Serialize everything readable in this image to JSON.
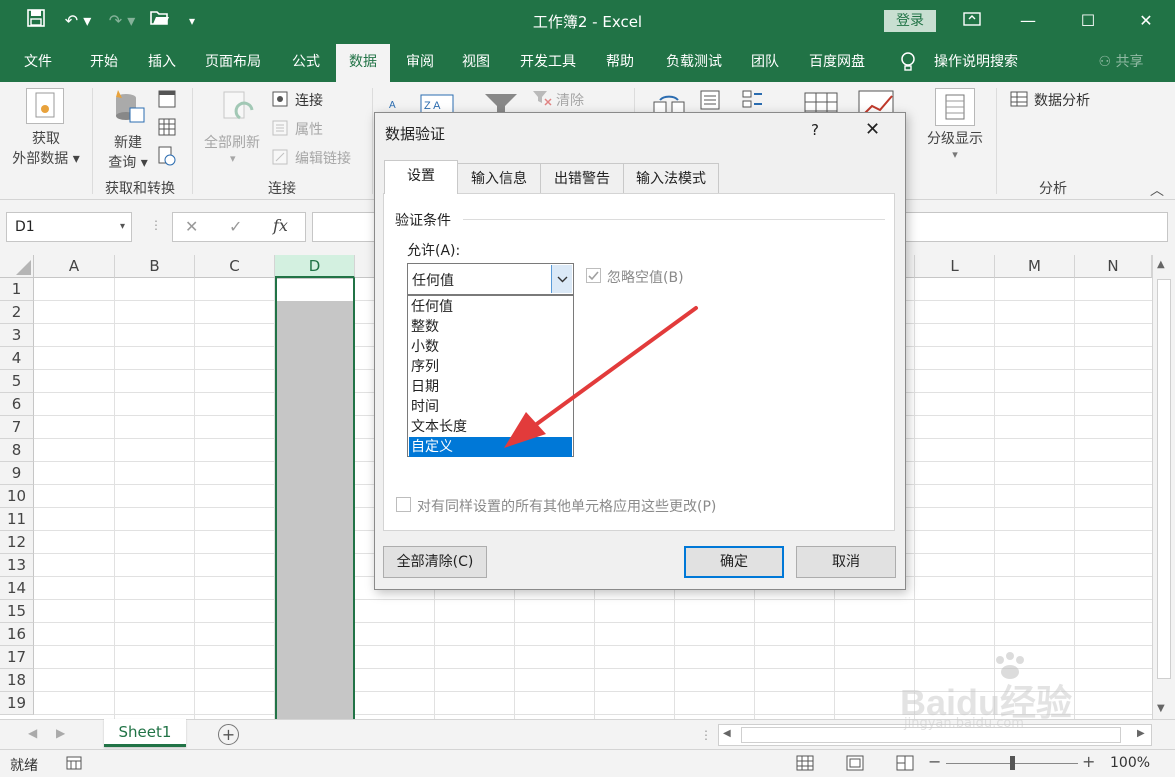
{
  "window": {
    "title": "工作簿2 - Excel",
    "login_label": "登录"
  },
  "tabs": [
    {
      "label": "文件"
    },
    {
      "label": "开始"
    },
    {
      "label": "插入"
    },
    {
      "label": "页面布局"
    },
    {
      "label": "公式"
    },
    {
      "label": "数据"
    },
    {
      "label": "审阅"
    },
    {
      "label": "视图"
    },
    {
      "label": "开发工具"
    },
    {
      "label": "帮助"
    },
    {
      "label": "负载测试"
    },
    {
      "label": "团队"
    },
    {
      "label": "百度网盘"
    }
  ],
  "tell_me": "操作说明搜索",
  "share": "共享",
  "ribbon": {
    "get_external_1": "获取",
    "get_external_2": "外部数据",
    "new_query_1": "新建",
    "new_query_2": "查询",
    "group_get_transform": "获取和转换",
    "refresh_all": "全部刷新",
    "connections": "连接",
    "properties": "属性",
    "edit_links": "编辑链接",
    "group_connections": "连接",
    "clear": "清除",
    "outline": "分级显示",
    "data_analysis": "数据分析",
    "group_analysis": "分析"
  },
  "formula_bar": {
    "name_box": "D1",
    "fx": "fx"
  },
  "grid": {
    "columns": [
      "A",
      "B",
      "C",
      "D",
      "",
      "",
      "",
      "",
      "",
      "",
      "L",
      "M",
      "N"
    ],
    "rows": [
      "1",
      "2",
      "3",
      "4",
      "5",
      "6",
      "7",
      "8",
      "9",
      "10",
      "11",
      "12",
      "13",
      "14",
      "15",
      "16",
      "17",
      "18",
      "19"
    ]
  },
  "sheet": {
    "name": "Sheet1"
  },
  "status": {
    "ready": "就绪",
    "zoom": "100%"
  },
  "dialog": {
    "title": "数据验证",
    "help": "?",
    "tabs": [
      {
        "label": "设置"
      },
      {
        "label": "输入信息"
      },
      {
        "label": "出错警告"
      },
      {
        "label": "输入法模式"
      }
    ],
    "section": "验证条件",
    "allow_label": "允许(A):",
    "allow_value": "任何值",
    "ignore_blank": "忽略空值(B)",
    "options": [
      "任何值",
      "整数",
      "小数",
      "序列",
      "日期",
      "时间",
      "文本长度",
      "自定义"
    ],
    "selected_option": "自定义",
    "apply_all": "对有同样设置的所有其他单元格应用这些更改(P)",
    "clear_all": "全部清除(C)",
    "ok": "确定",
    "cancel": "取消"
  },
  "watermark": {
    "brand": "Baidu经验",
    "url": "jingyan.baidu.com"
  }
}
